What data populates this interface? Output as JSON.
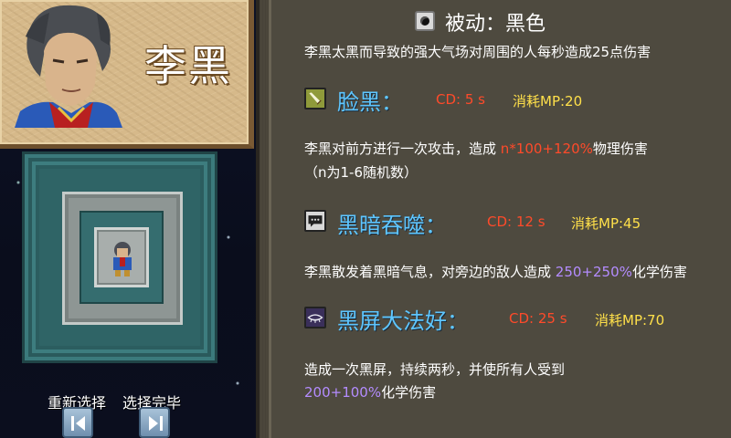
{
  "hero": {
    "name": "李黑"
  },
  "buttons": {
    "reselect": "重新选择",
    "confirm": "选择完毕"
  },
  "passive": {
    "title": "被动：黑色",
    "desc": "李黑太黑而导致的强大气场对周围的人每秒造成25点伤害",
    "icon": "dark-orb-icon"
  },
  "skills": [
    {
      "name": "脸黑：",
      "cd": "CD: 5 s",
      "mp": "消耗MP:20",
      "icon": "sword-icon",
      "desc_pre": "李黑对前方进行一次攻击，造成 ",
      "desc_hl": "n*100+120%",
      "desc_post": "物理伤害",
      "desc_line2": "（n为1-6随机数）"
    },
    {
      "name": "黑暗吞噬：",
      "cd": "CD: 12 s",
      "mp": "消耗MP:45",
      "icon": "speech-bubble-icon",
      "desc_pre": "李黑散发着黑暗气息，对旁边的敌人造成 ",
      "desc_hl": "250+250%",
      "desc_post": "化学伤害"
    },
    {
      "name": "黑屏大法好：",
      "cd": "CD: 25 s",
      "mp": "消耗MP:70",
      "icon": "closed-eye-icon",
      "desc_line1": "造成一次黑屏，持续两秒，并使所有人受到",
      "desc_hl": "200+100%",
      "desc_post": "化学伤害"
    }
  ],
  "colors": {
    "skill_name": "#5ec6ff",
    "cd": "#ff4a2a",
    "mp": "#ffe04a",
    "chemical": "#b48cff"
  }
}
